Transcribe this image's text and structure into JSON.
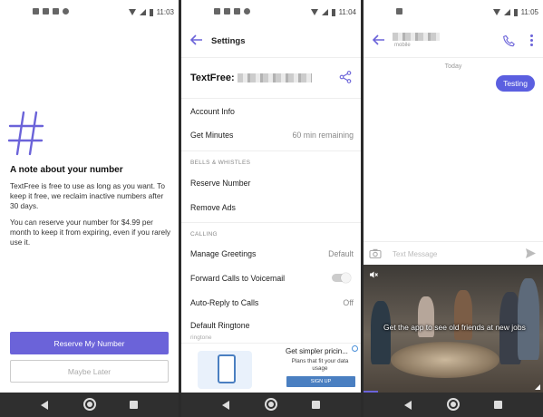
{
  "panel1": {
    "status": {
      "time": "11:03"
    },
    "note_title": "A note about your number",
    "note_p1": "TextFree is free to use as long as you want. To keep it free, we reclaim inactive numbers after 30 days.",
    "note_p2": "You can reserve your number for $4.99 per month to keep it from expiring, even if you rarely use it.",
    "reserve_button": "Reserve My Number",
    "later_button": "Maybe Later"
  },
  "panel2": {
    "status": {
      "time": "11:04"
    },
    "title": "Settings",
    "textfree_label": "TextFree:",
    "rows": {
      "account_info": "Account Info",
      "get_minutes": "Get Minutes",
      "get_minutes_value": "60 min remaining",
      "section_bells": "BELLS & WHISTLES",
      "reserve_number": "Reserve Number",
      "remove_ads": "Remove Ads",
      "section_calling": "CALLING",
      "manage_greetings": "Manage Greetings",
      "manage_greetings_value": "Default",
      "forward_calls": "Forward Calls to Voicemail",
      "auto_reply": "Auto-Reply to Calls",
      "auto_reply_value": "Off",
      "default_ringtone": "Default Ringtone",
      "ringtone_sub": "ringtone"
    },
    "ad": {
      "title": "Get simpler pricin...",
      "subtitle": "Plans that fit your data usage",
      "button": "SIGN UP"
    }
  },
  "panel3": {
    "status": {
      "time": "11:05"
    },
    "contact_sub": "mobile",
    "day_label": "Today",
    "message": "Testing",
    "composer_placeholder": "Text Message",
    "video_caption": "Get the app to see old friends at new jobs",
    "video_progress": 0.08
  },
  "colors": {
    "accent": "#6b63d9",
    "bubble": "#5b5fe0",
    "nav_bar": "#2f2f2f"
  }
}
